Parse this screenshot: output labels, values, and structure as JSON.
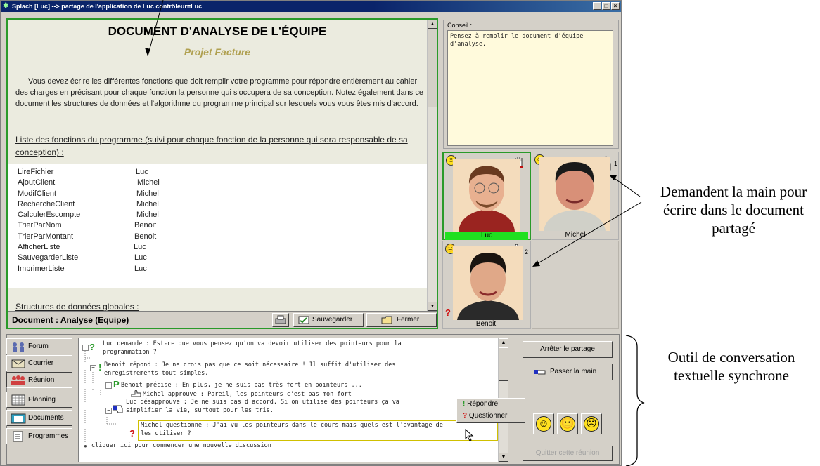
{
  "window": {
    "title": "Splach [Luc] --> partage de l'application de Luc contrôleur=Luc"
  },
  "document": {
    "title": "DOCUMENT D'ANALYSE DE L'ÉQUIPE",
    "subtitle": "Projet Facture",
    "intro": "Vous devez écrire les différentes fonctions que doit remplir votre programme pour répondre entièrement au cahier des charges en précisant pour chaque fonction la personne qui s'occupera de sa conception. Notez également dans ce document les structures de données et l'algorithme du programme principal sur lesquels vous vous êtes mis d'accord.",
    "functions_heading": "Liste des fonctions du programme (suivi pour chaque fonction de la personne qui sera responsable de sa conception) :",
    "functions": [
      {
        "name": "LireFichier",
        "person": "Luc"
      },
      {
        "name": "AjoutClient",
        "person": "Michel"
      },
      {
        "name": "ModifClient",
        "person": "Michel"
      },
      {
        "name": "RechercheClient",
        "person": "Michel"
      },
      {
        "name": "CalculerEscompte",
        "person": "Michel"
      },
      {
        "name": "TrierParNom",
        "person": "Benoit"
      },
      {
        "name": "TrierParMontant",
        "person": "Benoit"
      },
      {
        "name": "AfficherListe",
        "person": "Luc"
      },
      {
        "name": "SauvegarderListe",
        "person": "Luc"
      },
      {
        "name": "ImprimerListe",
        "person": "Luc"
      }
    ],
    "structures_heading": "Structures de données globales :",
    "footer_label": "Document : Analyse (Equipe)",
    "save_label": "Sauvegarder",
    "close_label": "Fermer"
  },
  "conseil": {
    "label": "Conseil :",
    "text": "Pensez à remplir le document d'équipe d'analyse."
  },
  "participants": [
    {
      "name": "Luc",
      "mood": "happy",
      "status": "holds-hand",
      "active": true
    },
    {
      "name": "Michel",
      "mood": "happy",
      "status": "requests-hand",
      "queue": "1"
    },
    {
      "name": "Benoit",
      "mood": "neutral",
      "status": "requests-hand",
      "queue": "2"
    }
  ],
  "nav": [
    {
      "label": "Forum",
      "icon": "forum-icon"
    },
    {
      "label": "Courrier",
      "icon": "mail-icon"
    },
    {
      "label": "Réunion",
      "icon": "meeting-icon"
    },
    {
      "label": "Planning",
      "icon": "calendar-icon"
    },
    {
      "label": "Documents",
      "icon": "documents-icon"
    },
    {
      "label": "Programmes",
      "icon": "programs-icon"
    }
  ],
  "chat": [
    {
      "icon": "?",
      "lines": [
        "Luc demande : Est-ce que vous pensez qu'on va devoir utiliser des pointeurs pour la",
        "programmation ?"
      ]
    },
    {
      "icon": "!",
      "lines": [
        "Benoit répond : Je ne crois pas que ce soit nécessaire ! Il suffit d'utiliser des",
        "enregistrements tout simples."
      ]
    },
    {
      "icon": "P",
      "lines": [
        "Benoit précise : En plus, je ne suis pas très fort en pointeurs ..."
      ]
    },
    {
      "icon": "approve",
      "lines": [
        "Michel approuve : Pareil, les pointeurs c'est pas mon fort !"
      ]
    },
    {
      "icon": "disapprove",
      "lines": [
        "Luc désapprouve : Je ne suis pas d'accord. Si on utilise des pointeurs ça va",
        "simplifier la vie, surtout pour les tris."
      ]
    },
    {
      "icon": "?",
      "lines": [
        "Michel questionne : J'ai vu les pointeurs dans le cours mais quels est l'avantage de",
        "les utiliser ?"
      ]
    }
  ],
  "chat_new": "cliquer ici pour commencer une nouvelle discussion",
  "context_menu": [
    "Répondre",
    "Questionner"
  ],
  "actions": {
    "stop_sharing": "Arrêter le partage",
    "pass_hand": "Passer la main",
    "quit_meeting": "Quitter cette réunion"
  },
  "annotations": {
    "hands": "Demandent la main pour écrire dans le document partagé",
    "chat": "Outil de conversation textuelle synchrone"
  }
}
